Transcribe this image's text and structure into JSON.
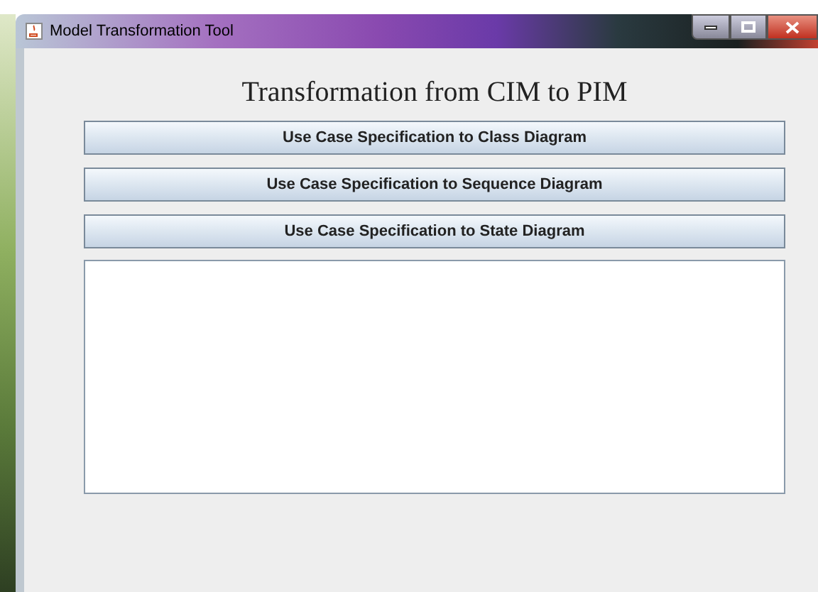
{
  "window": {
    "title": "Model Transformation Tool"
  },
  "heading": "Transformation from CIM to PIM",
  "buttons": [
    "Use Case Specification to Class Diagram",
    "Use Case Specification to Sequence Diagram",
    "Use Case Specification to State Diagram"
  ]
}
